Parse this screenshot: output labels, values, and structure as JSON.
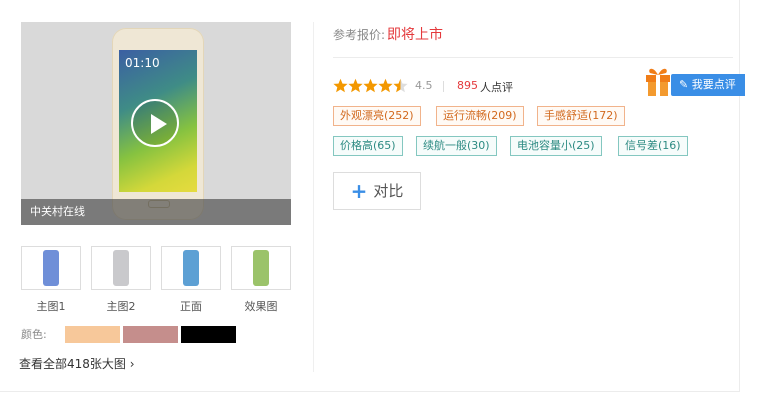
{
  "video": {
    "caption": "中关村在线",
    "screen_time": "01:10"
  },
  "thumbnails": [
    {
      "label": "主图1",
      "tint": "#6f8fd8"
    },
    {
      "label": "主图2",
      "tint": "#c9c9cc"
    },
    {
      "label": "正面",
      "tint": "#5da0d4"
    },
    {
      "label": "效果图",
      "tint": "#9bc36a"
    }
  ],
  "colors": {
    "label": "颜色:",
    "swatches": [
      "#f7c89a",
      "#c58e8c",
      "#000000"
    ]
  },
  "all_pics_link": "查看全部418张大图 ›",
  "price": {
    "label": "参考报价:",
    "value": "即将上市"
  },
  "rating": {
    "score": "4.5",
    "count": "895",
    "count_suffix": "人点评"
  },
  "write_review": "✎ 我要点评",
  "positive_tags": [
    "外观漂亮(252)",
    "运行流畅(209)",
    "手感舒适(172)"
  ],
  "negative_tags": [
    "价格高(65)",
    "续航一般(30)",
    "电池容量小(25)",
    "信号差(16)"
  ],
  "compare": {
    "plus": "+",
    "label": "对比"
  }
}
